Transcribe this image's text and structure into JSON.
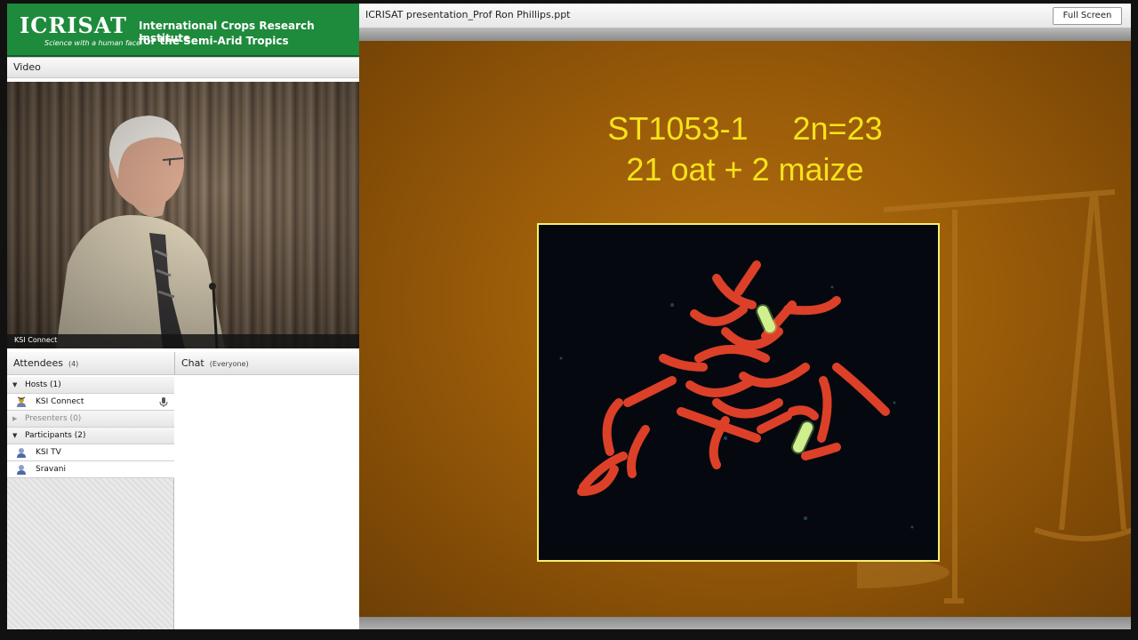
{
  "logo": {
    "mark": "ICRISAT",
    "tagline": "Science with a human face",
    "org_line1": "International Crops Research Institute",
    "org_line2": "for the Semi-Arid Tropics"
  },
  "video_pod": {
    "title": "Video",
    "caption": "KSI Connect"
  },
  "attendees_pod": {
    "title": "Attendees",
    "count": "(4)",
    "groups": [
      {
        "label": "Hosts (1)",
        "expanded": true,
        "members": [
          {
            "name": "KSI Connect",
            "icon": "host-icon"
          }
        ]
      },
      {
        "label": "Presenters (0)",
        "expanded": false,
        "members": []
      },
      {
        "label": "Participants (2)",
        "expanded": true,
        "members": [
          {
            "name": "KSI TV",
            "icon": "user-icon"
          },
          {
            "name": "Sravani",
            "icon": "user-icon"
          }
        ]
      }
    ]
  },
  "chat_pod": {
    "title": "Chat",
    "scope": "(Everyone)"
  },
  "share_pod": {
    "title": "ICRISAT presentation_Prof Ron Phillips.ppt",
    "fullscreen_label": "Full Screen"
  },
  "slide": {
    "line1": "ST1053-1     2n=23",
    "line2": "21 oat + 2 maize"
  },
  "colors": {
    "brand_green": "#1e8a3c",
    "slide_text": "#f5e21a",
    "slide_bg": "#9b5c09",
    "micrograph_border": "#f4ef70",
    "chromosome_red": "#e8432a",
    "chromosome_yellow": "#e6f6a0"
  }
}
